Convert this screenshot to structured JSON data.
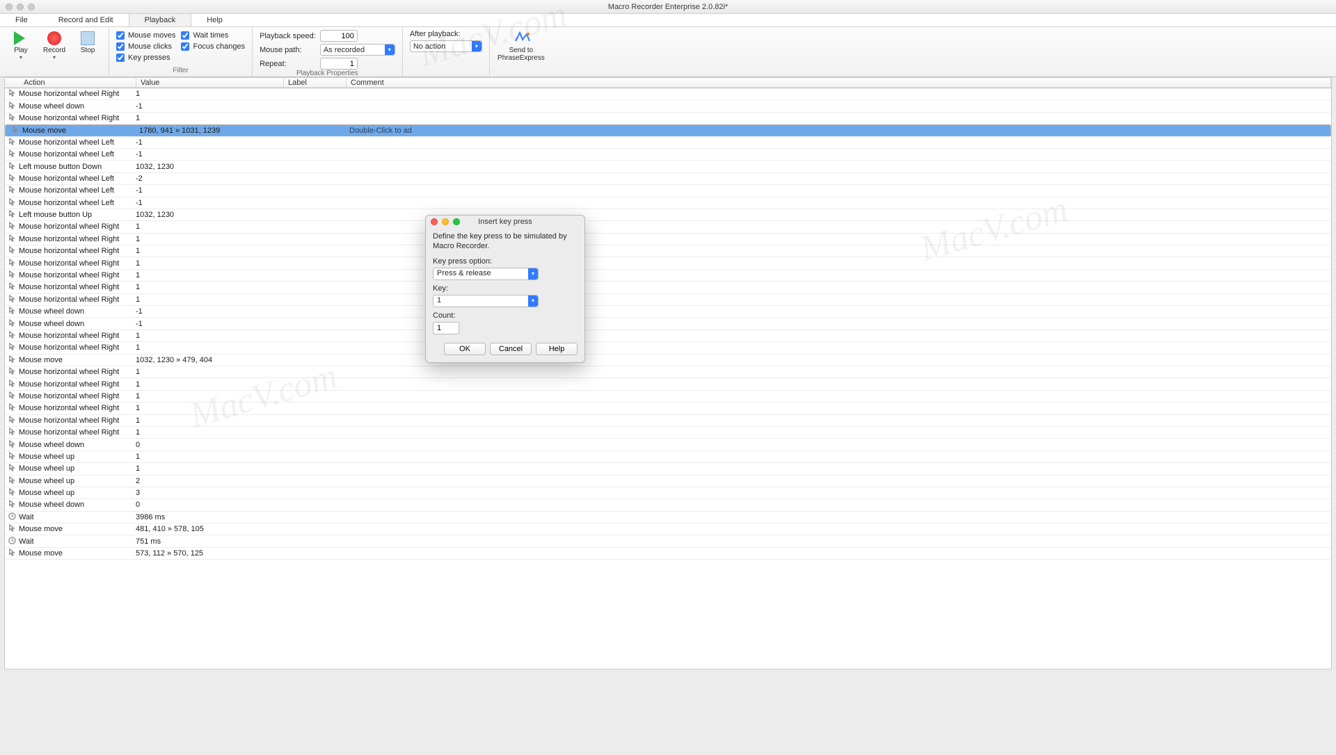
{
  "window": {
    "title": "Macro Recorder Enterprise 2.0.82i*"
  },
  "menu": {
    "file": "File",
    "record_edit": "Record and Edit",
    "playback": "Playback",
    "help": "Help",
    "active": "playback"
  },
  "toolbar": {
    "play": "Play",
    "record": "Record",
    "stop": "Stop",
    "filter_group": "Filter",
    "filters": {
      "mouse_moves": "Mouse moves",
      "mouse_clicks": "Mouse clicks",
      "key_presses": "Key presses",
      "wait_times": "Wait times",
      "focus_changes": "Focus changes"
    },
    "playback_group": "Playback Properties",
    "speed_label": "Playback speed:",
    "speed_value": "100",
    "path_label": "Mouse path:",
    "path_value": "As recorded",
    "repeat_label": "Repeat:",
    "repeat_value": "1",
    "after_label": "After playback:",
    "after_value": "No action",
    "sendto": "Send to\nPhraseExpress"
  },
  "columns": {
    "action": "Action",
    "value": "Value",
    "label": "Label",
    "comment": "Comment"
  },
  "rows": [
    {
      "i": "m",
      "a": "Mouse horizontal wheel Right",
      "v": "1"
    },
    {
      "i": "m",
      "a": "Mouse wheel down",
      "v": "-1"
    },
    {
      "i": "m",
      "a": "Mouse horizontal wheel Right",
      "v": "1"
    },
    {
      "i": "m",
      "a": "Mouse move",
      "v": "1780, 941 » 1031, 1239",
      "l": "",
      "c": "Double-Click to ad",
      "sel": true
    },
    {
      "i": "m",
      "a": "Mouse horizontal wheel Left",
      "v": "-1"
    },
    {
      "i": "m",
      "a": "Mouse horizontal wheel Left",
      "v": "-1"
    },
    {
      "i": "m",
      "a": "Left mouse button Down",
      "v": "1032, 1230"
    },
    {
      "i": "m",
      "a": "Mouse horizontal wheel Left",
      "v": "-2"
    },
    {
      "i": "m",
      "a": "Mouse horizontal wheel Left",
      "v": "-1"
    },
    {
      "i": "m",
      "a": "Mouse horizontal wheel Left",
      "v": "-1"
    },
    {
      "i": "m",
      "a": "Left mouse button Up",
      "v": "1032, 1230"
    },
    {
      "i": "m",
      "a": "Mouse horizontal wheel Right",
      "v": "1"
    },
    {
      "i": "m",
      "a": "Mouse horizontal wheel Right",
      "v": "1"
    },
    {
      "i": "m",
      "a": "Mouse horizontal wheel Right",
      "v": "1"
    },
    {
      "i": "m",
      "a": "Mouse horizontal wheel Right",
      "v": "1"
    },
    {
      "i": "m",
      "a": "Mouse horizontal wheel Right",
      "v": "1"
    },
    {
      "i": "m",
      "a": "Mouse horizontal wheel Right",
      "v": "1"
    },
    {
      "i": "m",
      "a": "Mouse horizontal wheel Right",
      "v": "1"
    },
    {
      "i": "m",
      "a": "Mouse wheel down",
      "v": "-1"
    },
    {
      "i": "m",
      "a": "Mouse wheel down",
      "v": "-1"
    },
    {
      "i": "m",
      "a": "Mouse horizontal wheel Right",
      "v": "1"
    },
    {
      "i": "m",
      "a": "Mouse horizontal wheel Right",
      "v": "1"
    },
    {
      "i": "m",
      "a": "Mouse move",
      "v": "1032, 1230 » 479, 404"
    },
    {
      "i": "m",
      "a": "Mouse horizontal wheel Right",
      "v": "1"
    },
    {
      "i": "m",
      "a": "Mouse horizontal wheel Right",
      "v": "1"
    },
    {
      "i": "m",
      "a": "Mouse horizontal wheel Right",
      "v": "1"
    },
    {
      "i": "m",
      "a": "Mouse horizontal wheel Right",
      "v": "1"
    },
    {
      "i": "m",
      "a": "Mouse horizontal wheel Right",
      "v": "1"
    },
    {
      "i": "m",
      "a": "Mouse horizontal wheel Right",
      "v": "1"
    },
    {
      "i": "m",
      "a": "Mouse wheel down",
      "v": "0"
    },
    {
      "i": "m",
      "a": "Mouse wheel up",
      "v": "1"
    },
    {
      "i": "m",
      "a": "Mouse wheel up",
      "v": "1"
    },
    {
      "i": "m",
      "a": "Mouse wheel up",
      "v": "2"
    },
    {
      "i": "m",
      "a": "Mouse wheel up",
      "v": "3"
    },
    {
      "i": "m",
      "a": "Mouse wheel down",
      "v": "0"
    },
    {
      "i": "t",
      "a": "Wait",
      "v": "3986 ms"
    },
    {
      "i": "m",
      "a": "Mouse move",
      "v": "481, 410 » 578, 105"
    },
    {
      "i": "t",
      "a": "Wait",
      "v": "751 ms"
    },
    {
      "i": "m",
      "a": "Mouse move",
      "v": "573, 112 » 570, 125"
    }
  ],
  "dialog": {
    "title": "Insert key press",
    "description": "Define the key press to be simulated by Macro Recorder.",
    "option_label": "Key press option:",
    "option_value": "Press & release",
    "key_label": "Key:",
    "key_value": "1",
    "count_label": "Count:",
    "count_value": "1",
    "ok": "OK",
    "cancel": "Cancel",
    "help": "Help"
  },
  "watermark": "MacV.com"
}
